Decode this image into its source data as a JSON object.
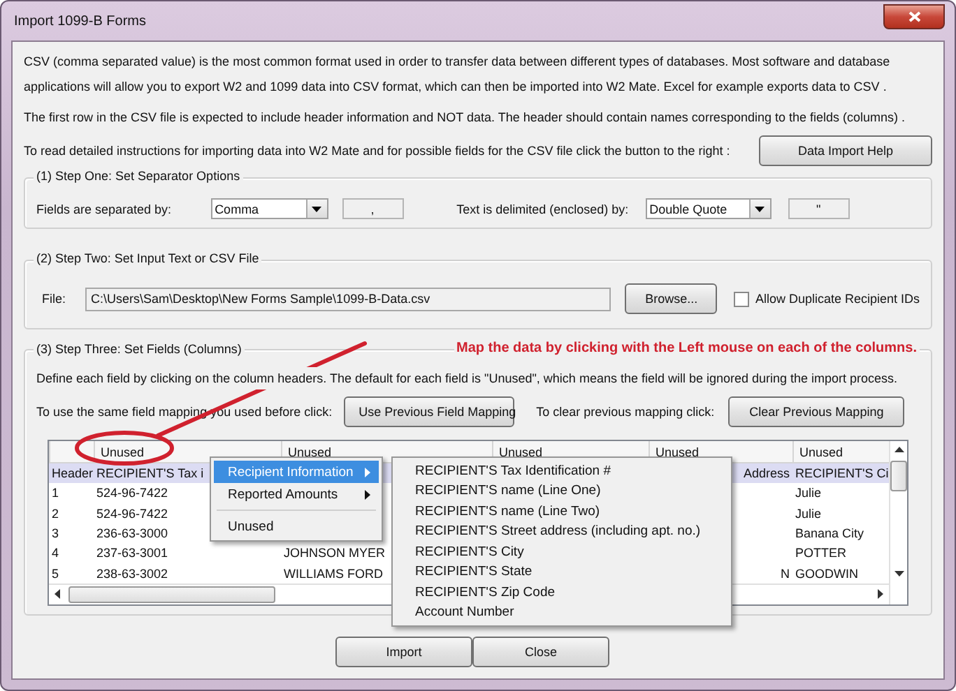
{
  "window": {
    "title": "Import 1099-B Forms"
  },
  "intro": {
    "paragraphs": [
      "CSV (comma separated value) is the most common format used in order to transfer data between different types of databases.  Most software and database applications will allow you to export W2 and 1099 data into CSV format, which can then be imported into W2 Mate. Excel for example exports data to CSV .",
      "The first row in the CSV file is expected to include header information and NOT data. The header should contain names corresponding to the fields (columns) ."
    ],
    "help_prompt": "To read detailed instructions for importing data into W2 Mate and for possible fields for the CSV file click the button to the right :",
    "help_button": "Data Import Help"
  },
  "step_one": {
    "title": "(1)  Step One: Set Separator Options",
    "fields_label": "Fields are separated by:",
    "fields_select": "Comma",
    "fields_char": ",",
    "text_label": "Text is delimited (enclosed) by:",
    "text_select": "Double Quote",
    "text_char": "\""
  },
  "step_two": {
    "title": "(2)  Step Two: Set Input Text or CSV File",
    "file_label": "File:",
    "file_value": "C:\\Users\\Sam\\Desktop\\New Forms Sample\\1099-B-Data.csv",
    "browse_button": "Browse...",
    "duplicates": {
      "label": "Allow Duplicate Recipient IDs",
      "checked": false
    }
  },
  "step_three": {
    "title": "(3)  Step Three: Set Fields (Columns)",
    "annotation": "Map the data by clicking with the Left mouse on each of the columns.",
    "description": "Define each field by clicking on the column headers. The default for each field is \"Unused\", which means the field will be ignored during the import process.",
    "previous_label": "To use the same field mapping you used before click:",
    "previous_button": "Use Previous Field Mapping",
    "clear_label": "To clear previous mapping click:",
    "clear_button": "Clear Previous Mapping",
    "grid": {
      "columns": [
        "Unused",
        "Unused",
        "Unused",
        "Unused",
        "Unused"
      ],
      "rows": [
        {
          "label": "Header",
          "column_1": "RECIPIENT'S Tax i",
          "column_4": "Address",
          "column_5": "RECIPIENT'S Ci"
        },
        {
          "label": "1",
          "column_1": "524-96-7422",
          "column_5": "Julie"
        },
        {
          "label": "2",
          "column_1": "524-96-7422",
          "column_5": "Julie"
        },
        {
          "label": "3",
          "column_1": "236-63-3000",
          "column_5": "Banana City"
        },
        {
          "label": "4",
          "column_1": "237-63-3001",
          "column_2": "JOHNSON MYER",
          "column_5": "POTTER"
        },
        {
          "label": "5",
          "column_1": "238-63-3002",
          "column_2": "WILLIAMS FORD",
          "column_4": "N",
          "column_5": "GOODWIN"
        }
      ]
    }
  },
  "context_menu": {
    "items": [
      {
        "kind": "submenu",
        "label": "Recipient Information",
        "selected": true
      },
      {
        "kind": "submenu",
        "label": "Reported Amounts",
        "selected": false
      },
      {
        "kind": "separator"
      },
      {
        "kind": "item",
        "label": "Unused",
        "selected": false
      }
    ],
    "submenu": [
      "RECIPIENT'S Tax Identification #",
      "RECIPIENT'S name (Line One)",
      "RECIPIENT'S name (Line Two)",
      "RECIPIENT'S Street address (including apt. no.)",
      "RECIPIENT'S City",
      "RECIPIENT'S State",
      "RECIPIENT'S Zip Code",
      "Account Number"
    ]
  },
  "buttons": [
    "Import",
    "Close"
  ]
}
